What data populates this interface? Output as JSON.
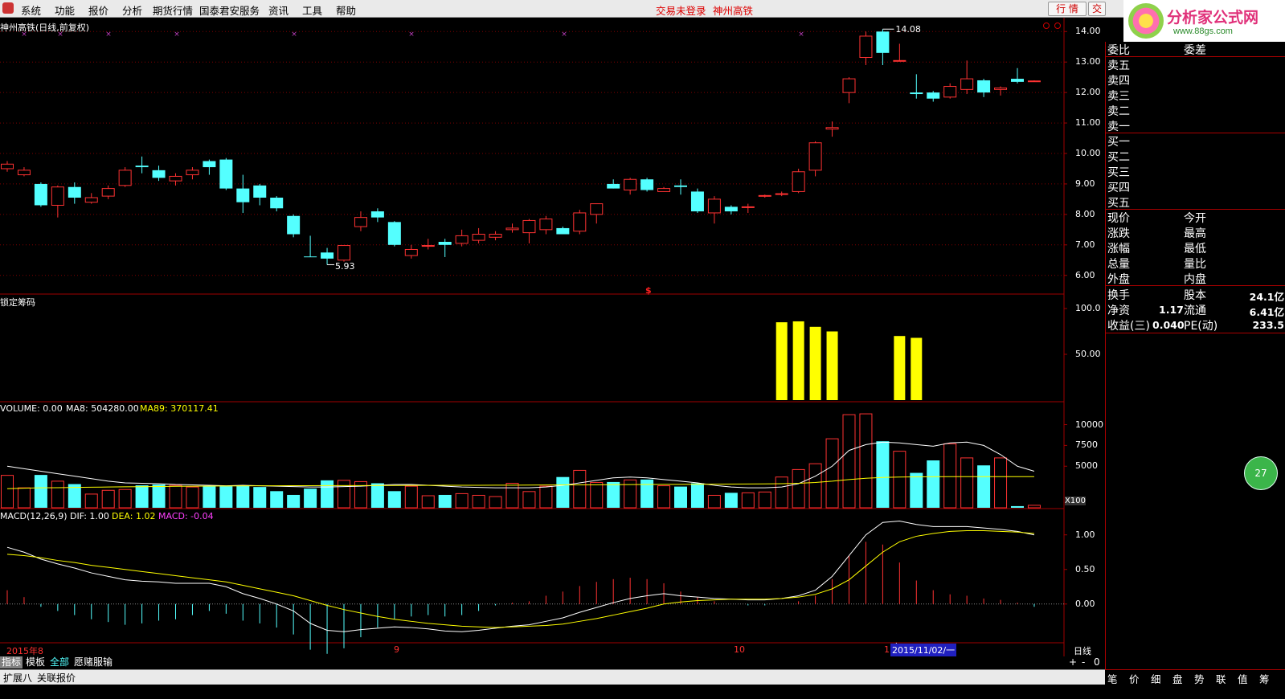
{
  "menu": {
    "items": [
      "系统",
      "功能",
      "报价",
      "分析",
      "期货行情",
      "国泰君安服务",
      "资讯",
      "工具",
      "帮助"
    ],
    "status_login": "交易未登录",
    "status_stock": "神州高铁",
    "btn_market": "行 情",
    "btn_trade": "交"
  },
  "brand": {
    "name": "分析家公式网",
    "url": "www.88gs.com"
  },
  "main": {
    "title": "神州高铁(日线,前复权)",
    "high_label": "14.08",
    "low_label": "5.93",
    "dollar_marker": "$",
    "price_axis": [
      "14.00",
      "13.00",
      "12.00",
      "11.00",
      "10.00",
      "9.00",
      "8.00",
      "7.00",
      "6.00"
    ]
  },
  "indicator1": {
    "title": "锁定筹码",
    "axis": [
      "100.0",
      "50.00"
    ]
  },
  "volume": {
    "title": "VOLUME: 0.00",
    "ma8": "MA8: 504280.00",
    "ma89": "MA89: 370117.41",
    "axis": [
      "10000",
      "7500",
      "5000"
    ],
    "unit": "X100"
  },
  "macd": {
    "title": "MACD(12,26,9)",
    "dif": "DIF: 1.00",
    "dea": "DEA: 1.02",
    "macd": "MACD: -0.04",
    "axis": [
      "1.00",
      "0.50",
      "0.00"
    ]
  },
  "timeline": {
    "year": "2015年8",
    "m9": "9",
    "m10": "10",
    "m11": "1",
    "cursor_date": "2015/11/02/一",
    "period": "日线"
  },
  "bottom_tabs": [
    "指标",
    "模板",
    "全部",
    "愿赌服输"
  ],
  "zoom": [
    "+",
    "-",
    "0"
  ],
  "statusbar": [
    "扩展八",
    "关联报价"
  ],
  "right_panel": {
    "header": [
      "委比",
      "委差"
    ],
    "sell": [
      "卖五",
      "卖四",
      "卖三",
      "卖二",
      "卖一"
    ],
    "buy": [
      "买一",
      "买二",
      "买三",
      "买四",
      "买五"
    ],
    "quote_left": [
      "现价",
      "涨跌",
      "涨幅",
      "总量",
      "外盘"
    ],
    "quote_right": [
      "今开",
      "最高",
      "最低",
      "量比",
      "内盘"
    ],
    "extra": [
      {
        "l": "换手",
        "m": "",
        "r": "股本",
        "v": "24.1亿"
      },
      {
        "l": "净资",
        "m": "1.17",
        "r": "流通",
        "v": "6.41亿"
      },
      {
        "l": "收益(三)",
        "m": "0.040",
        "r": "PE(动)",
        "v": "233.5"
      }
    ],
    "tabs": [
      "笔",
      "价",
      "细",
      "盘",
      "势",
      "联",
      "值",
      "筹"
    ],
    "green_btn": "27"
  },
  "colors": {
    "up": "#ff3232",
    "down": "#54ffff",
    "ma": "#ffff00",
    "axis": "#a00000",
    "grid": "#800000"
  },
  "chart_data": {
    "type": "candlestick",
    "ohlc": [
      [
        9.5,
        9.65,
        9.75,
        9.4
      ],
      [
        9.3,
        9.45,
        9.55,
        9.25
      ],
      [
        9.0,
        8.3,
        9.05,
        8.25
      ],
      [
        8.3,
        8.9,
        8.95,
        7.9
      ],
      [
        8.9,
        8.55,
        9.05,
        8.35
      ],
      [
        8.4,
        8.55,
        8.7,
        8.35
      ],
      [
        8.6,
        8.85,
        8.95,
        8.5
      ],
      [
        8.95,
        9.45,
        9.55,
        8.9
      ],
      [
        9.6,
        9.55,
        9.9,
        9.35
      ],
      [
        9.45,
        9.2,
        9.6,
        9.1
      ],
      [
        9.1,
        9.25,
        9.35,
        8.95
      ],
      [
        9.3,
        9.45,
        9.55,
        9.15
      ],
      [
        9.75,
        9.55,
        9.8,
        9.3
      ],
      [
        9.8,
        8.85,
        9.85,
        8.8
      ],
      [
        8.85,
        8.4,
        9.3,
        8.05
      ],
      [
        8.95,
        8.55,
        9.0,
        8.3
      ],
      [
        8.55,
        8.2,
        8.6,
        8.1
      ],
      [
        7.95,
        7.35,
        8.0,
        7.25
      ],
      [
        6.62,
        6.6,
        7.3,
        6.6
      ],
      [
        6.75,
        6.55,
        6.9,
        6.35
      ],
      [
        6.5,
        6.98,
        6.98,
        6.45
      ],
      [
        7.6,
        7.9,
        8.1,
        7.45
      ],
      [
        8.1,
        7.9,
        8.2,
        7.75
      ],
      [
        7.75,
        7.0,
        7.78,
        6.95
      ],
      [
        6.65,
        6.85,
        7.0,
        6.55
      ],
      [
        6.98,
        6.98,
        7.2,
        6.85
      ],
      [
        7.1,
        7.0,
        7.2,
        6.6
      ],
      [
        7.05,
        7.3,
        7.5,
        6.95
      ],
      [
        7.15,
        7.35,
        7.55,
        7.05
      ],
      [
        7.25,
        7.35,
        7.45,
        7.15
      ],
      [
        7.5,
        7.55,
        7.7,
        7.4
      ],
      [
        7.4,
        7.8,
        7.85,
        7.05
      ],
      [
        7.5,
        7.85,
        7.95,
        7.35
      ],
      [
        7.55,
        7.35,
        7.6,
        7.35
      ],
      [
        7.45,
        8.05,
        8.15,
        7.35
      ],
      [
        8.0,
        8.35,
        8.35,
        7.7
      ],
      [
        9.0,
        8.85,
        9.15,
        8.85
      ],
      [
        8.8,
        9.15,
        9.2,
        8.65
      ],
      [
        9.15,
        8.8,
        9.2,
        8.75
      ],
      [
        8.75,
        8.85,
        8.9,
        8.75
      ],
      [
        8.95,
        8.9,
        9.15,
        8.65
      ],
      [
        8.75,
        8.1,
        8.85,
        8.05
      ],
      [
        8.05,
        8.5,
        8.6,
        7.7
      ],
      [
        8.25,
        8.1,
        8.3,
        8.0
      ],
      [
        8.25,
        8.25,
        8.35,
        8.05
      ],
      [
        8.62,
        8.62,
        8.65,
        8.55
      ],
      [
        8.68,
        8.68,
        8.75,
        8.6
      ],
      [
        8.75,
        9.4,
        9.5,
        8.7
      ],
      [
        9.45,
        10.35,
        10.4,
        9.25
      ],
      [
        10.8,
        10.85,
        11.05,
        10.55
      ],
      [
        12.0,
        12.45,
        12.5,
        11.65
      ],
      [
        13.15,
        13.85,
        14.0,
        12.9
      ],
      [
        14.0,
        13.3,
        14.08,
        12.9
      ],
      [
        13.05,
        13.05,
        13.6,
        13.05
      ],
      [
        12.0,
        11.95,
        12.6,
        11.8
      ],
      [
        12.0,
        11.8,
        12.05,
        11.7
      ],
      [
        11.85,
        12.2,
        12.3,
        11.8
      ],
      [
        12.1,
        12.45,
        13.05,
        11.95
      ],
      [
        12.4,
        12.0,
        12.45,
        11.85
      ],
      [
        12.1,
        12.15,
        12.2,
        11.9
      ],
      [
        12.45,
        12.35,
        12.8,
        12.3
      ],
      [
        12.38,
        12.38,
        12.4,
        12.35
      ]
    ],
    "lock_chips": [
      0,
      0,
      0,
      0,
      0,
      0,
      0,
      0,
      0,
      0,
      0,
      0,
      0,
      0,
      0,
      0,
      0,
      0,
      0,
      0,
      0,
      0,
      0,
      0,
      0,
      0,
      0,
      0,
      0,
      0,
      0,
      0,
      0,
      0,
      0,
      0,
      0,
      0,
      0,
      0,
      0,
      0,
      0,
      0,
      0,
      0,
      85,
      86,
      80,
      75,
      0,
      0,
      0,
      70,
      68,
      0,
      0,
      0,
      0,
      0,
      0,
      0
    ],
    "volume": [
      3900,
      2400,
      3950,
      3200,
      2850,
      1650,
      2100,
      2200,
      2700,
      2800,
      2700,
      2500,
      2600,
      2600,
      2700,
      2500,
      2000,
      1550,
      2300,
      3300,
      3300,
      3150,
      2950,
      2000,
      2600,
      1450,
      1550,
      1700,
      1500,
      1350,
      2950,
      1950,
      2600,
      3700,
      4500,
      3050,
      3100,
      3350,
      3400,
      2650,
      2550,
      2950,
      1500,
      1800,
      1800,
      1900,
      3700,
      4600,
      5300,
      8300,
      11200,
      11300,
      8000,
      6800,
      4200,
      5700,
      7700,
      6000,
      5100,
      6000,
      200,
      300
    ],
    "vol_ma8": [
      5000,
      4700,
      4400,
      4100,
      3800,
      3500,
      3200,
      3000,
      2950,
      2900,
      2800,
      2750,
      2700,
      2650,
      2700,
      2650,
      2600,
      2550,
      2500,
      2500,
      2550,
      2600,
      2700,
      2800,
      2800,
      2700,
      2600,
      2500,
      2450,
      2400,
      2400,
      2400,
      2500,
      2700,
      3000,
      3300,
      3600,
      3700,
      3600,
      3400,
      3200,
      3000,
      2700,
      2500,
      2400,
      2400,
      2500,
      2900,
      3800,
      5000,
      6900,
      7600,
      7900,
      7800,
      7600,
      7400,
      7800,
      7900,
      7500,
      6400,
      5000,
      4400
    ],
    "vol_ma89": [
      2300,
      2350,
      2400,
      2420,
      2450,
      2480,
      2500,
      2520,
      2540,
      2560,
      2580,
      2600,
      2610,
      2620,
      2630,
      2640,
      2650,
      2655,
      2660,
      2665,
      2670,
      2675,
      2680,
      2685,
      2690,
      2695,
      2700,
      2705,
      2710,
      2715,
      2720,
      2730,
      2740,
      2750,
      2760,
      2770,
      2780,
      2790,
      2800,
      2810,
      2820,
      2830,
      2840,
      2850,
      2860,
      2870,
      2900,
      2950,
      3050,
      3200,
      3400,
      3550,
      3650,
      3700,
      3720,
      3730,
      3740,
      3745,
      3745,
      3745,
      3745,
      3745
    ],
    "dif": [
      0.82,
      0.75,
      0.65,
      0.58,
      0.52,
      0.45,
      0.4,
      0.35,
      0.33,
      0.32,
      0.3,
      0.3,
      0.3,
      0.25,
      0.15,
      0.08,
      0.0,
      -0.1,
      -0.28,
      -0.38,
      -0.4,
      -0.37,
      -0.35,
      -0.33,
      -0.34,
      -0.36,
      -0.39,
      -0.4,
      -0.38,
      -0.35,
      -0.32,
      -0.3,
      -0.25,
      -0.2,
      -0.12,
      -0.05,
      0.02,
      0.08,
      0.12,
      0.15,
      0.12,
      0.1,
      0.08,
      0.07,
      0.06,
      0.06,
      0.08,
      0.12,
      0.2,
      0.4,
      0.7,
      1.0,
      1.18,
      1.2,
      1.15,
      1.12,
      1.12,
      1.12,
      1.1,
      1.08,
      1.05,
      1.0
    ],
    "dea": [
      0.72,
      0.7,
      0.67,
      0.63,
      0.6,
      0.56,
      0.53,
      0.5,
      0.47,
      0.44,
      0.41,
      0.38,
      0.35,
      0.32,
      0.27,
      0.22,
      0.17,
      0.12,
      0.05,
      -0.02,
      -0.08,
      -0.13,
      -0.18,
      -0.22,
      -0.25,
      -0.28,
      -0.3,
      -0.32,
      -0.33,
      -0.34,
      -0.33,
      -0.32,
      -0.31,
      -0.29,
      -0.25,
      -0.21,
      -0.16,
      -0.11,
      -0.06,
      0.0,
      0.03,
      0.05,
      0.06,
      0.07,
      0.07,
      0.07,
      0.08,
      0.1,
      0.14,
      0.22,
      0.35,
      0.55,
      0.75,
      0.9,
      0.98,
      1.02,
      1.05,
      1.06,
      1.06,
      1.05,
      1.04,
      1.02
    ],
    "macd_axis": {
      "min": -0.56,
      "max": 1.38
    },
    "price_axis": {
      "min": 5.65,
      "max": 14.35
    },
    "vol_axis": {
      "min": 0,
      "max": 11500
    },
    "x_labels": {
      "2015年8": 0,
      "9": 24,
      "10": 44,
      "1": 53
    },
    "cursor_index": 53
  }
}
